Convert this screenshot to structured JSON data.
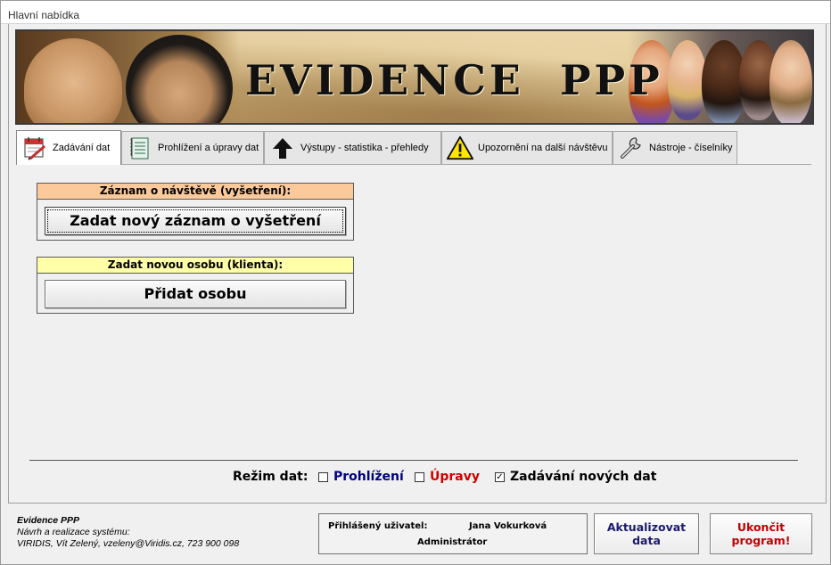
{
  "window": {
    "title": "Hlavní nabídka"
  },
  "banner": {
    "title": "EVIDENCE  PPP"
  },
  "tabs": [
    {
      "label": "Zadávání dat",
      "icon": "calendar-pencil-icon",
      "active": true
    },
    {
      "label": "Prohlížení a úpravy dat",
      "icon": "notepad-icon",
      "active": false
    },
    {
      "label": "Výstupy - statistika - přehledy",
      "icon": "up-arrow-icon",
      "active": false
    },
    {
      "label": "Upozornění na další návštěvu",
      "icon": "warning-icon",
      "active": false
    },
    {
      "label": "Nástroje - číselníky",
      "icon": "wrench-icon",
      "active": false
    }
  ],
  "record_panel": {
    "header": "Záznam o návštěvě (vyšetření):",
    "header_color": "#fbc99a",
    "button_label": "Zadat nový záznam o vyšetření"
  },
  "person_panel": {
    "header": "Zadat novou osobu (klienta):",
    "header_color": "#ffffa8",
    "button_label": "Přidat osobu"
  },
  "data_mode": {
    "label": "Režim dat:",
    "options": [
      {
        "label": "Prohlížení",
        "checked": false,
        "color": "#000080"
      },
      {
        "label": "Úpravy",
        "checked": false,
        "color": "#d00000"
      },
      {
        "label": "Zadávání nových dat",
        "checked": true,
        "color": "#000000"
      }
    ]
  },
  "footer": {
    "app_name": "Evidence PPP",
    "design_line": "Návrh a realizace systému:",
    "author_line": "VIRIDIS, Vít Zelený, vzeleny@Viridis.cz, 723 900 098",
    "user_label": "Přihlášený uživatel:",
    "user_name": "Jana Vokurková",
    "user_role": "Administrátor",
    "refresh_button": "Aktualizovat\ndata",
    "refresh_color": "#1a1a6e",
    "exit_button": "Ukončit\nprogram!",
    "exit_color": "#c00000"
  }
}
